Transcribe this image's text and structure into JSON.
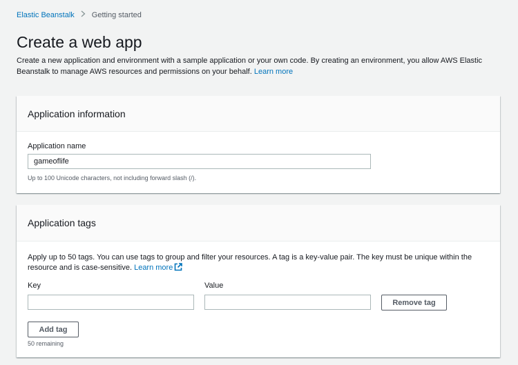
{
  "breadcrumb": {
    "items": [
      {
        "label": "Elastic Beanstalk",
        "link": true
      },
      {
        "label": "Getting started",
        "link": false
      }
    ]
  },
  "page": {
    "title": "Create a web app",
    "description": "Create a new application and environment with a sample application or your own code. By creating an environment, you allow AWS Elastic Beanstalk to manage AWS resources and permissions on your behalf.",
    "learn_more": "Learn more"
  },
  "app_info": {
    "heading": "Application information",
    "name_label": "Application name",
    "name_value": "gameoflife",
    "name_hint": "Up to 100 Unicode characters, not including forward slash (/)."
  },
  "app_tags": {
    "heading": "Application tags",
    "description": "Apply up to 50 tags. You can use tags to group and filter your resources. A tag is a key-value pair. The key must be unique within the resource and is case-sensitive.",
    "learn_more": "Learn more",
    "key_label": "Key",
    "value_label": "Value",
    "key_value": "",
    "value_value": "",
    "remove_tag_label": "Remove tag",
    "add_tag_label": "Add tag",
    "remaining": "50 remaining"
  },
  "icons": {
    "breadcrumb_separator": "chevron-right-icon",
    "learn_more_external": "external-link-icon"
  },
  "colors": {
    "link": "#0073bb",
    "background": "#f2f3f3",
    "panel_header": "#fafafa"
  }
}
